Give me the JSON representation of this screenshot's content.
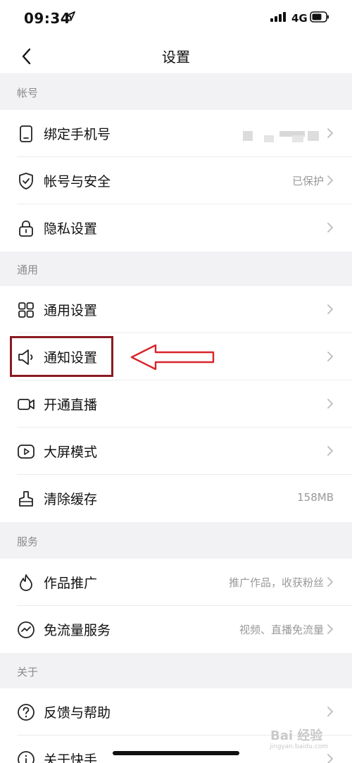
{
  "status_bar": {
    "time": "09:34",
    "network": "4G"
  },
  "header": {
    "title": "设置"
  },
  "sections": [
    {
      "title": "帐号"
    },
    {
      "title": "通用"
    },
    {
      "title": "服务"
    },
    {
      "title": "关于"
    }
  ],
  "rows": {
    "phone": {
      "label": "绑定手机号",
      "icon": "phone-icon"
    },
    "security": {
      "label": "帐号与安全",
      "value": "已保护",
      "icon": "shield-icon"
    },
    "privacy": {
      "label": "隐私设置",
      "icon": "lock-icon"
    },
    "general": {
      "label": "通用设置",
      "icon": "grid-icon"
    },
    "notify": {
      "label": "通知设置",
      "icon": "speaker-icon"
    },
    "live": {
      "label": "开通直播",
      "icon": "video-camera-icon"
    },
    "bigscreen": {
      "label": "大屏模式",
      "icon": "play-icon"
    },
    "cache": {
      "label": "清除缓存",
      "value": "158MB",
      "icon": "broom-icon"
    },
    "promote": {
      "label": "作品推广",
      "value": "推广作品，收获粉丝",
      "icon": "flame-icon"
    },
    "traffic": {
      "label": "免流量服务",
      "value": "视频、直播免流量",
      "icon": "wave-icon"
    },
    "feedback": {
      "label": "反馈与帮助",
      "icon": "help-icon"
    },
    "about": {
      "label": "关于快手",
      "icon": "info-icon"
    }
  },
  "watermark": {
    "brand": "Bai  经验",
    "url": "jingyan.baidu.com"
  },
  "colors": {
    "highlight": "#8a1a22",
    "arrow": "#d9252b",
    "section_bg": "#f2f2f4",
    "muted": "#999999"
  }
}
